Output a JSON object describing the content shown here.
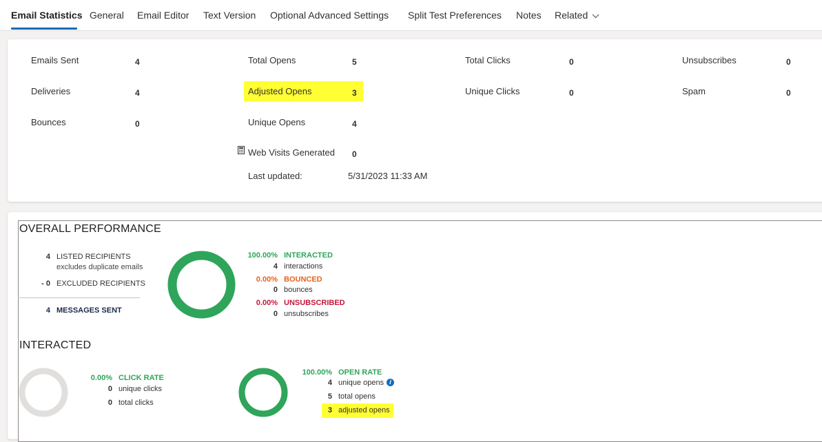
{
  "tabs": [
    {
      "label": "Email Statistics",
      "active": true
    },
    {
      "label": "General"
    },
    {
      "label": "Email Editor"
    },
    {
      "label": "Text Version"
    },
    {
      "label": "Optional Advanced Settings"
    },
    {
      "label": "Split Test Preferences"
    },
    {
      "label": "Notes"
    },
    {
      "label": "Related"
    }
  ],
  "stats": {
    "emails_sent": {
      "label": "Emails Sent",
      "value": "4"
    },
    "deliveries": {
      "label": "Deliveries",
      "value": "4"
    },
    "bounces": {
      "label": "Bounces",
      "value": "0"
    },
    "total_opens": {
      "label": "Total Opens",
      "value": "5"
    },
    "adjusted_opens": {
      "label": "Adjusted Opens",
      "value": "3"
    },
    "unique_opens": {
      "label": "Unique Opens",
      "value": "4"
    },
    "web_visits": {
      "label": "Web Visits Generated",
      "value": "0",
      "icon": "calculator-icon"
    },
    "last_updated": {
      "label": "Last updated:",
      "value": "5/31/2023 11:33 AM"
    },
    "total_clicks": {
      "label": "Total Clicks",
      "value": "0"
    },
    "unique_clicks": {
      "label": "Unique Clicks",
      "value": "0"
    },
    "unsubscribes": {
      "label": "Unsubscribes",
      "value": "0"
    },
    "spam": {
      "label": "Spam",
      "value": "0"
    }
  },
  "overall": {
    "title": "OVERALL PERFORMANCE",
    "listed": {
      "num": "4",
      "label": "LISTED RECIPIENTS",
      "sub": "excludes duplicate emails"
    },
    "excluded": {
      "num": "- 0",
      "label": "EXCLUDED RECIPIENTS"
    },
    "sent": {
      "num": "4",
      "label": "MESSAGES SENT"
    },
    "donut_fraction": 1.0,
    "interacted": {
      "pct": "100.00%",
      "label": "INTERACTED",
      "count": "4",
      "unit": "interactions"
    },
    "bounced": {
      "pct": "0.00%",
      "label": "BOUNCED",
      "count": "0",
      "unit": "bounces"
    },
    "unsubscribed": {
      "pct": "0.00%",
      "label": "UNSUBSCRIBED",
      "count": "0",
      "unit": "unsubscribes"
    }
  },
  "interacted": {
    "title": "INTERACTED",
    "click": {
      "pct": "0.00%",
      "label": "CLICK RATE",
      "unique_num": "0",
      "unique_label": "unique clicks",
      "total_num": "0",
      "total_label": "total clicks",
      "fraction": 0.0
    },
    "open": {
      "pct": "100.00%",
      "label": "OPEN RATE",
      "unique_num": "4",
      "unique_label": "unique opens",
      "total_num": "5",
      "total_label": "total opens",
      "adjusted_num": "3",
      "adjusted_label": "adjusted opens",
      "fraction": 1.0
    }
  },
  "colors": {
    "accent": "#0f6cbd",
    "highlight": "#ffff33",
    "green": "#2ea55a",
    "orange": "#e8631a",
    "red": "#c4173c",
    "ring_empty": "#e1dfdd"
  }
}
